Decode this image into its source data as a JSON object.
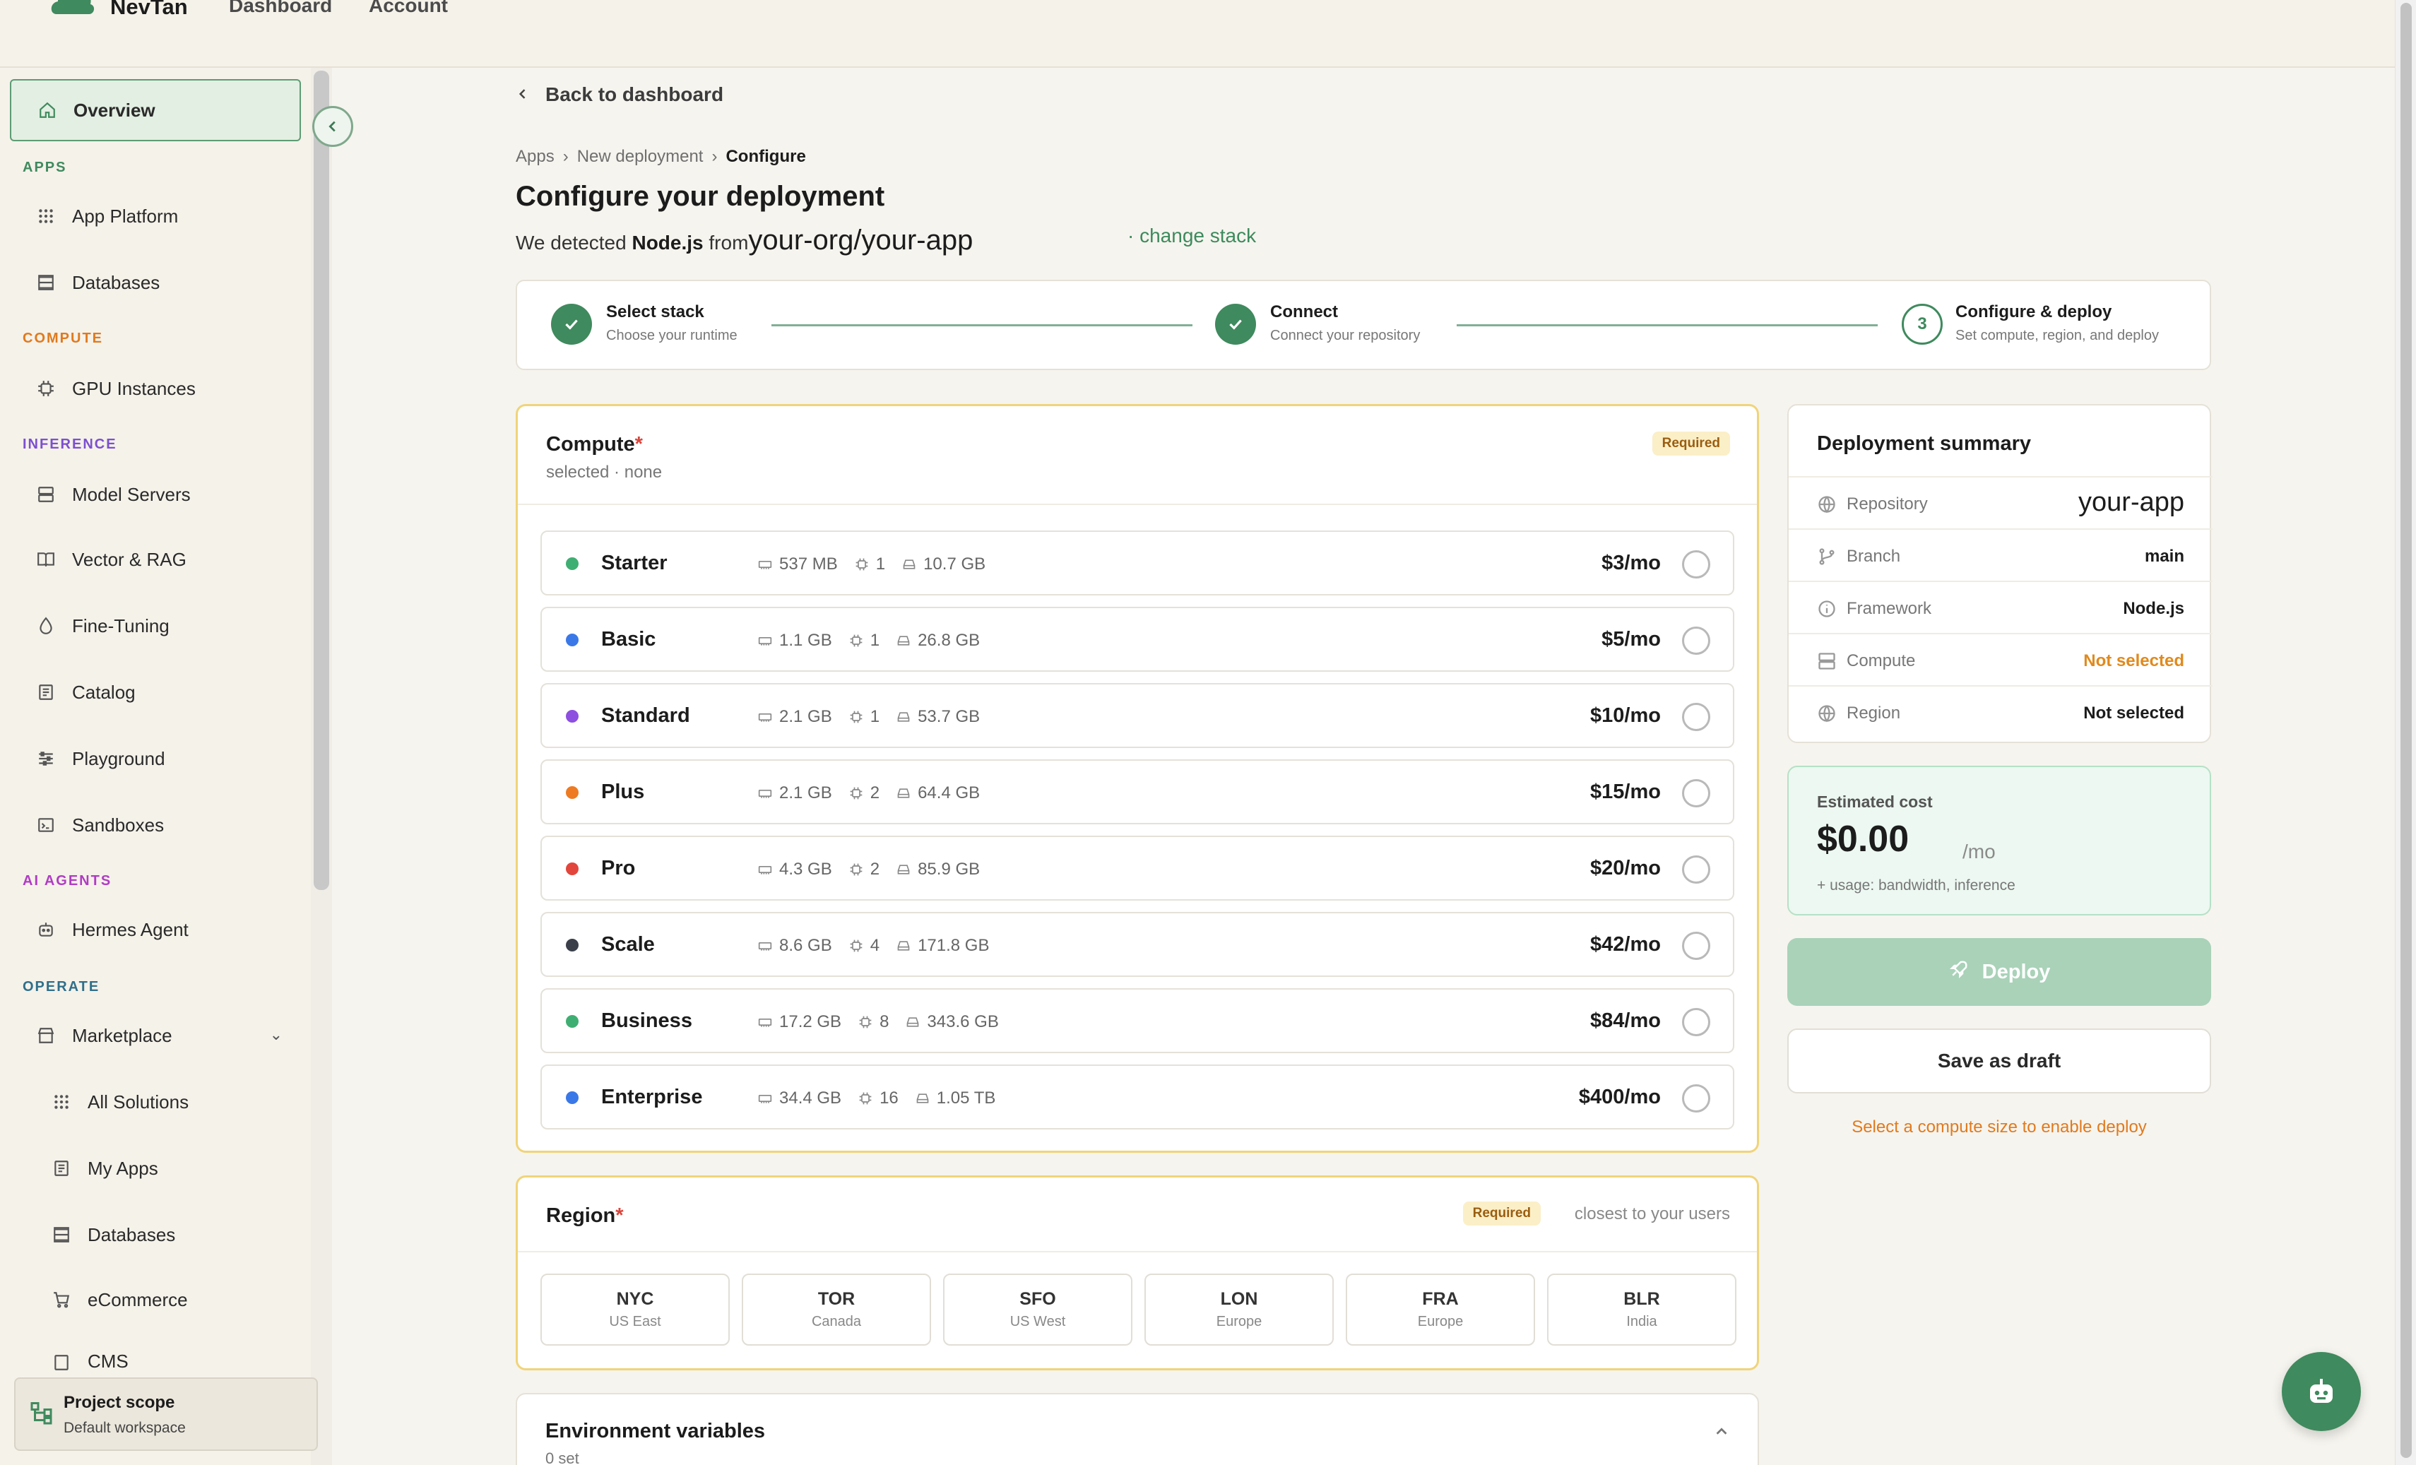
{
  "app": {
    "name": "NevTan"
  },
  "topnav": {
    "dashboard": "Dashboard",
    "account": "Account"
  },
  "sidebar": {
    "overview": "Overview",
    "sections": {
      "apps": "APPS",
      "compute": "COMPUTE",
      "inference": "INFERENCE",
      "ai_agents": "AI AGENTS",
      "operate": "OPERATE"
    },
    "items": {
      "app_platform": "App Platform",
      "databases": "Databases",
      "gpu_instances": "GPU Instances",
      "model_servers": "Model Servers",
      "vector_rag": "Vector & RAG",
      "fine_tuning": "Fine-Tuning",
      "catalog": "Catalog",
      "playground": "Playground",
      "sandboxes": "Sandboxes",
      "hermes_agent": "Hermes Agent",
      "marketplace": "Marketplace",
      "all_solutions": "All Solutions",
      "my_apps": "My Apps",
      "databases_sub": "Databases",
      "ecommerce": "eCommerce",
      "cms_partial": "CMS"
    },
    "project_scope": {
      "title": "Project scope",
      "subtitle": "Default workspace"
    },
    "section_colors": {
      "apps": "#3f8a5e",
      "compute": "#e07a1e",
      "inference": "#7c4fd0",
      "ai_agents": "#b03cc4",
      "operate": "#2f6f8a"
    }
  },
  "main": {
    "back_link": "Back to dashboard",
    "breadcrumb": {
      "apps": "Apps",
      "new_deployment": "New deployment",
      "current": "Configure",
      "sep": "›"
    },
    "title": "Configure your deployment",
    "detect": {
      "prefix": "We detected",
      "framework": "Node.js",
      "from": "from",
      "repo": "your-org/your-app",
      "change_stack": "· change stack"
    },
    "stepper": {
      "steps": [
        {
          "title": "Select stack",
          "sub": "Choose your runtime",
          "state": "done"
        },
        {
          "title": "Connect",
          "sub": "Connect your repository",
          "state": "done"
        },
        {
          "title": "Configure & deploy",
          "sub": "Set compute, region, and deploy",
          "state": "current",
          "num": "3"
        }
      ]
    },
    "compute": {
      "title": "Compute",
      "star": "*",
      "required": "Required",
      "subtitle": "selected · none",
      "tiers": [
        {
          "name": "Starter",
          "ram": "537 MB",
          "cpu": "1",
          "disk": "10.7 GB",
          "price": "$3/mo",
          "color": "#3fae72"
        },
        {
          "name": "Basic",
          "ram": "1.1 GB",
          "cpu": "1",
          "disk": "26.8 GB",
          "price": "$5/mo",
          "color": "#3b78e7"
        },
        {
          "name": "Standard",
          "ram": "2.1 GB",
          "cpu": "1",
          "disk": "53.7 GB",
          "price": "$10/mo",
          "color": "#8c4fe0"
        },
        {
          "name": "Plus",
          "ram": "2.1 GB",
          "cpu": "2",
          "disk": "64.4 GB",
          "price": "$15/mo",
          "color": "#ee7a22"
        },
        {
          "name": "Pro",
          "ram": "4.3 GB",
          "cpu": "2",
          "disk": "85.9 GB",
          "price": "$20/mo",
          "color": "#e2453b"
        },
        {
          "name": "Scale",
          "ram": "8.6 GB",
          "cpu": "4",
          "disk": "171.8 GB",
          "price": "$42/mo",
          "color": "#3a3f4a"
        },
        {
          "name": "Business",
          "ram": "17.2 GB",
          "cpu": "8",
          "disk": "343.6 GB",
          "price": "$84/mo",
          "color": "#3fae72"
        },
        {
          "name": "Enterprise",
          "ram": "34.4 GB",
          "cpu": "16",
          "disk": "1.05 TB",
          "price": "$400/mo",
          "color": "#3b78e7"
        }
      ]
    },
    "region": {
      "title": "Region",
      "star": "*",
      "required": "Required",
      "hint": "closest to your users",
      "options": [
        {
          "code": "NYC",
          "loc": "US East"
        },
        {
          "code": "TOR",
          "loc": "Canada"
        },
        {
          "code": "SFO",
          "loc": "US West"
        },
        {
          "code": "LON",
          "loc": "Europe"
        },
        {
          "code": "FRA",
          "loc": "Europe"
        },
        {
          "code": "BLR",
          "loc": "India"
        }
      ]
    },
    "env": {
      "title": "Environment variables",
      "sub": "0 set"
    }
  },
  "summary": {
    "title": "Deployment summary",
    "rows": [
      {
        "label": "Repository",
        "value": "your-app"
      },
      {
        "label": "Branch",
        "value": "main"
      },
      {
        "label": "Framework",
        "value": "Node.js"
      },
      {
        "label": "Compute",
        "value": "Not selected"
      },
      {
        "label": "Region",
        "value": "Not selected"
      }
    ],
    "cost": {
      "label": "Estimated cost",
      "value": "$0.00",
      "per": "/mo",
      "note": "+ usage: bandwidth, inference"
    },
    "deploy": "Deploy",
    "draft": "Save as draft",
    "hint": "Select a compute size to enable deploy"
  }
}
